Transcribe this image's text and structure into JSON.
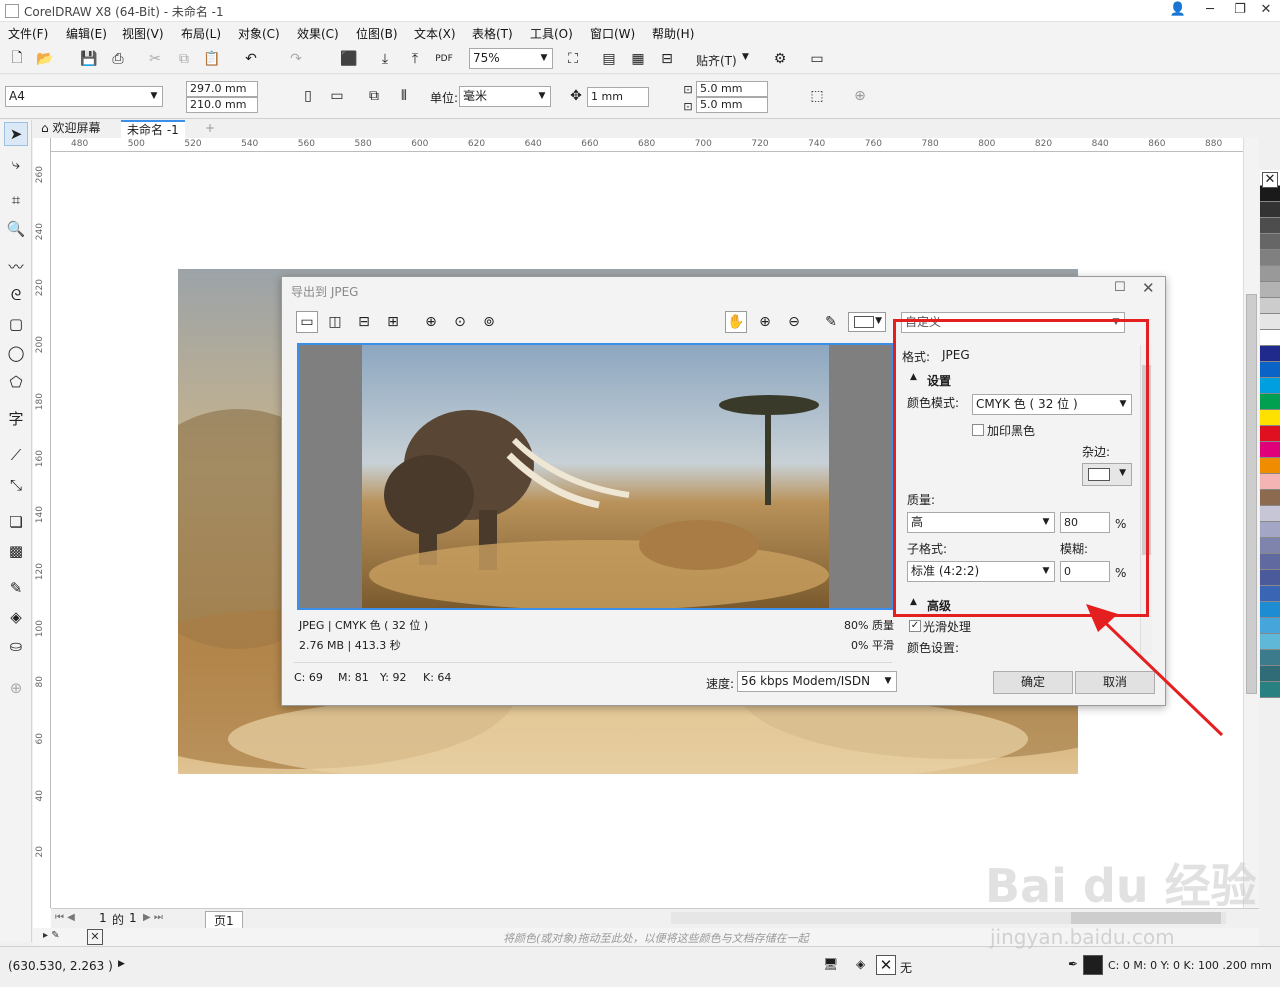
{
  "window": {
    "title": "CorelDRAW X8 (64-Bit) - 未命名 -1"
  },
  "menu": [
    "文件(F)",
    "编辑(E)",
    "视图(V)",
    "布局(L)",
    "对象(C)",
    "效果(C)",
    "位图(B)",
    "文本(X)",
    "表格(T)",
    "工具(O)",
    "窗口(W)",
    "帮助(H)"
  ],
  "toolbar": {
    "zoom": "75%",
    "snap_label": "贴齐(T)"
  },
  "propbar": {
    "page_size": "A4",
    "width": "297.0 mm",
    "height": "210.0 mm",
    "unit_label": "单位:",
    "unit_value": "毫米",
    "nudge": "1 mm",
    "dup_x": "5.0 mm",
    "dup_y": "5.0 mm"
  },
  "doc_tabs": {
    "welcome": "欢迎屏幕",
    "doc": "未命名 -1"
  },
  "ruler_h": [
    "480",
    "500",
    "520",
    "540",
    "560",
    "580",
    "600",
    "620",
    "640",
    "660",
    "680",
    "700",
    "720",
    "740",
    "760",
    "780",
    "800",
    "820",
    "840",
    "860",
    "880"
  ],
  "ruler_v": [
    "260",
    "240",
    "220",
    "200",
    "180",
    "160",
    "140",
    "120",
    "100",
    "80",
    "60",
    "40",
    "20"
  ],
  "page_nav": {
    "current": "1",
    "of": "的",
    "total": "1",
    "page_tab": "页1"
  },
  "hint_text": "将颜色(或对象)拖动至此处，以便将这些颜色与文档存储在一起",
  "status": {
    "coords": "(630.530, 2.263 )",
    "fill_none": "无",
    "outline": "C: 0 M: 0 Y: 0 K: 100  .200 mm"
  },
  "dialog": {
    "title": "导出到 JPEG",
    "preset": "自定义",
    "format_label": "格式:",
    "format_value": "JPEG",
    "settings_header": "设置",
    "color_mode_label": "颜色模式:",
    "color_mode_value": "CMYK 色 ( 32 位 )",
    "overprint_label": "加印黑色",
    "matte_label": "杂边:",
    "quality_label": "质量:",
    "quality_value": "高",
    "quality_num": "80",
    "quality_pct": "%",
    "subformat_label": "子格式:",
    "subformat_value": "标准 (4:2:2)",
    "blur_label": "模糊:",
    "blur_num": "0",
    "blur_pct": "%",
    "advanced_header": "高级",
    "smooth_label": "光滑处理",
    "color_settings_label": "颜色设置:",
    "info_format": "JPEG  |  CMYK 色 ( 32 位 )",
    "info_size": "2.76 MB  |  413.3 秒",
    "info_quality": "80% 质量",
    "info_smooth": "0% 平滑",
    "cmyk": {
      "c": "C: 69",
      "m": "M: 81",
      "y": "Y: 92",
      "k": "K: 64"
    },
    "speed_label": "速度:",
    "speed_value": "56 kbps Modem/ISDN",
    "ok": "确定",
    "cancel": "取消"
  },
  "watermark": {
    "logo": "Bai du 经验",
    "url": "jingyan.baidu.com"
  },
  "palette": [
    "#ffffff",
    "#1a1a1a",
    "#333333",
    "#4d4d4d",
    "#666666",
    "#808080",
    "#999999",
    "#b3b3b3",
    "#cccccc",
    "#e6e6e6",
    "#ffffff",
    "#1f2a8c",
    "#0a64c8",
    "#00a0e0",
    "#00a050",
    "#ffe100",
    "#e01020",
    "#e0007a",
    "#f08c00",
    "#f5b4b4",
    "#8c6a4f",
    "#c6c6d6",
    "#a3a6c4",
    "#7f84ad",
    "#606aa0",
    "#4a5a9a",
    "#3a64b4",
    "#1e8cd2",
    "#46a6dc",
    "#5fb8d8",
    "#3c7b8c",
    "#306c78",
    "#288080"
  ],
  "accent": {
    "red_annotation": "#e41f1f",
    "preview_border": "#3b8fe8"
  }
}
